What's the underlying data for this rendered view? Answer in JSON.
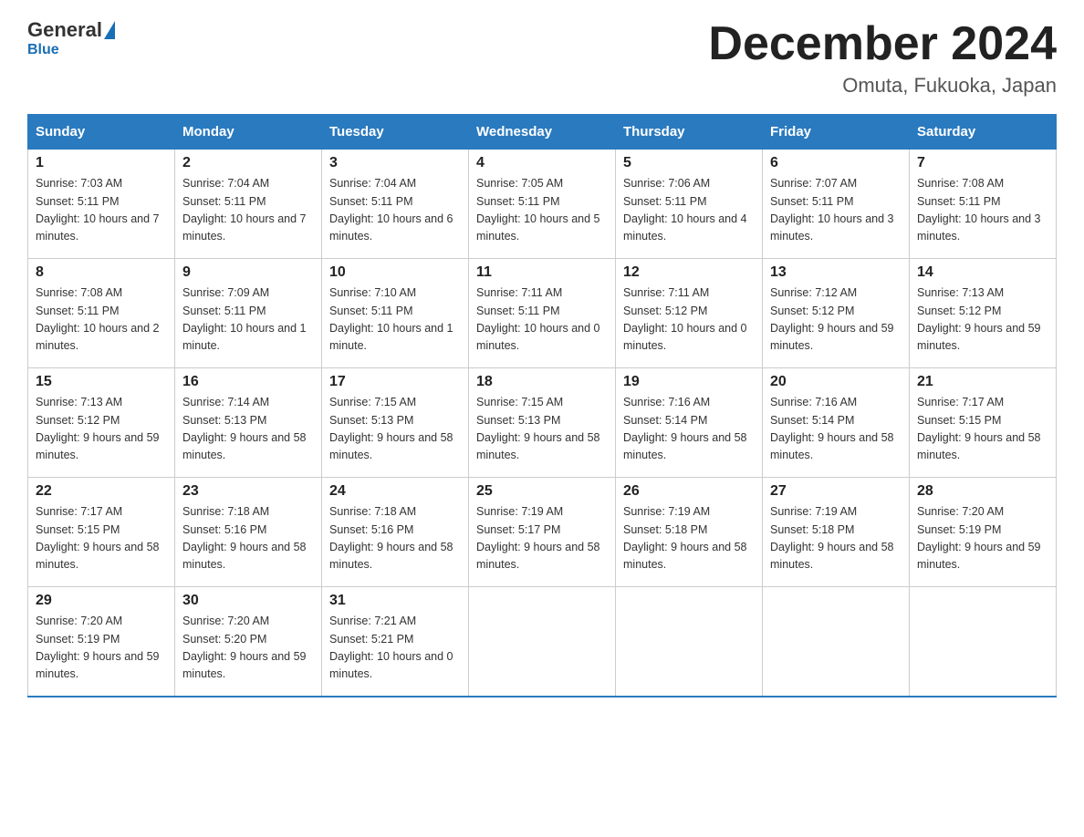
{
  "logo": {
    "general": "General",
    "blue": "Blue"
  },
  "header": {
    "month_title": "December 2024",
    "location": "Omuta, Fukuoka, Japan"
  },
  "days_of_week": [
    "Sunday",
    "Monday",
    "Tuesday",
    "Wednesday",
    "Thursday",
    "Friday",
    "Saturday"
  ],
  "weeks": [
    [
      {
        "day": "1",
        "sunrise": "7:03 AM",
        "sunset": "5:11 PM",
        "daylight": "10 hours and 7 minutes."
      },
      {
        "day": "2",
        "sunrise": "7:04 AM",
        "sunset": "5:11 PM",
        "daylight": "10 hours and 7 minutes."
      },
      {
        "day": "3",
        "sunrise": "7:04 AM",
        "sunset": "5:11 PM",
        "daylight": "10 hours and 6 minutes."
      },
      {
        "day": "4",
        "sunrise": "7:05 AM",
        "sunset": "5:11 PM",
        "daylight": "10 hours and 5 minutes."
      },
      {
        "day": "5",
        "sunrise": "7:06 AM",
        "sunset": "5:11 PM",
        "daylight": "10 hours and 4 minutes."
      },
      {
        "day": "6",
        "sunrise": "7:07 AM",
        "sunset": "5:11 PM",
        "daylight": "10 hours and 3 minutes."
      },
      {
        "day": "7",
        "sunrise": "7:08 AM",
        "sunset": "5:11 PM",
        "daylight": "10 hours and 3 minutes."
      }
    ],
    [
      {
        "day": "8",
        "sunrise": "7:08 AM",
        "sunset": "5:11 PM",
        "daylight": "10 hours and 2 minutes."
      },
      {
        "day": "9",
        "sunrise": "7:09 AM",
        "sunset": "5:11 PM",
        "daylight": "10 hours and 1 minute."
      },
      {
        "day": "10",
        "sunrise": "7:10 AM",
        "sunset": "5:11 PM",
        "daylight": "10 hours and 1 minute."
      },
      {
        "day": "11",
        "sunrise": "7:11 AM",
        "sunset": "5:11 PM",
        "daylight": "10 hours and 0 minutes."
      },
      {
        "day": "12",
        "sunrise": "7:11 AM",
        "sunset": "5:12 PM",
        "daylight": "10 hours and 0 minutes."
      },
      {
        "day": "13",
        "sunrise": "7:12 AM",
        "sunset": "5:12 PM",
        "daylight": "9 hours and 59 minutes."
      },
      {
        "day": "14",
        "sunrise": "7:13 AM",
        "sunset": "5:12 PM",
        "daylight": "9 hours and 59 minutes."
      }
    ],
    [
      {
        "day": "15",
        "sunrise": "7:13 AM",
        "sunset": "5:12 PM",
        "daylight": "9 hours and 59 minutes."
      },
      {
        "day": "16",
        "sunrise": "7:14 AM",
        "sunset": "5:13 PM",
        "daylight": "9 hours and 58 minutes."
      },
      {
        "day": "17",
        "sunrise": "7:15 AM",
        "sunset": "5:13 PM",
        "daylight": "9 hours and 58 minutes."
      },
      {
        "day": "18",
        "sunrise": "7:15 AM",
        "sunset": "5:13 PM",
        "daylight": "9 hours and 58 minutes."
      },
      {
        "day": "19",
        "sunrise": "7:16 AM",
        "sunset": "5:14 PM",
        "daylight": "9 hours and 58 minutes."
      },
      {
        "day": "20",
        "sunrise": "7:16 AM",
        "sunset": "5:14 PM",
        "daylight": "9 hours and 58 minutes."
      },
      {
        "day": "21",
        "sunrise": "7:17 AM",
        "sunset": "5:15 PM",
        "daylight": "9 hours and 58 minutes."
      }
    ],
    [
      {
        "day": "22",
        "sunrise": "7:17 AM",
        "sunset": "5:15 PM",
        "daylight": "9 hours and 58 minutes."
      },
      {
        "day": "23",
        "sunrise": "7:18 AM",
        "sunset": "5:16 PM",
        "daylight": "9 hours and 58 minutes."
      },
      {
        "day": "24",
        "sunrise": "7:18 AM",
        "sunset": "5:16 PM",
        "daylight": "9 hours and 58 minutes."
      },
      {
        "day": "25",
        "sunrise": "7:19 AM",
        "sunset": "5:17 PM",
        "daylight": "9 hours and 58 minutes."
      },
      {
        "day": "26",
        "sunrise": "7:19 AM",
        "sunset": "5:18 PM",
        "daylight": "9 hours and 58 minutes."
      },
      {
        "day": "27",
        "sunrise": "7:19 AM",
        "sunset": "5:18 PM",
        "daylight": "9 hours and 58 minutes."
      },
      {
        "day": "28",
        "sunrise": "7:20 AM",
        "sunset": "5:19 PM",
        "daylight": "9 hours and 59 minutes."
      }
    ],
    [
      {
        "day": "29",
        "sunrise": "7:20 AM",
        "sunset": "5:19 PM",
        "daylight": "9 hours and 59 minutes."
      },
      {
        "day": "30",
        "sunrise": "7:20 AM",
        "sunset": "5:20 PM",
        "daylight": "9 hours and 59 minutes."
      },
      {
        "day": "31",
        "sunrise": "7:21 AM",
        "sunset": "5:21 PM",
        "daylight": "10 hours and 0 minutes."
      },
      null,
      null,
      null,
      null
    ]
  ]
}
